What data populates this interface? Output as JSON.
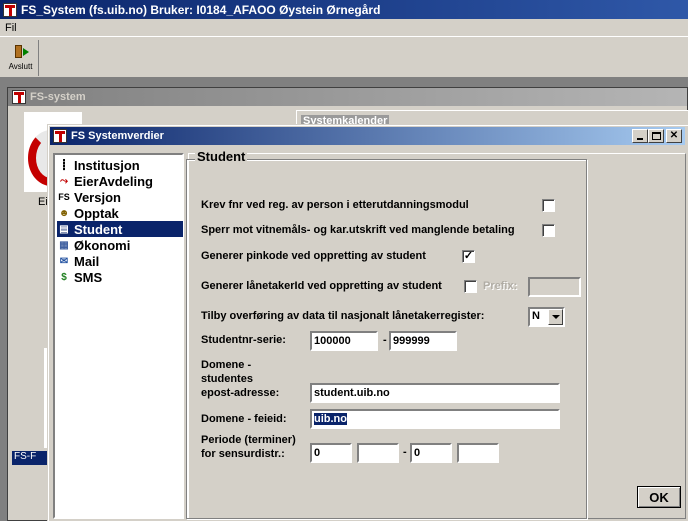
{
  "main_window": {
    "title": "FS_System (fs.uib.no) Bruker: I0184_AFAOO Øystein Ørnegård"
  },
  "menu": {
    "items": [
      "Fil"
    ]
  },
  "toolbar": {
    "exit_label": "Avslutt"
  },
  "background_window": {
    "title": "FS-system",
    "panel_label": "Systemkalender",
    "logo_caption": "Ei",
    "bottom_label": "FS-F"
  },
  "dialog": {
    "title": "FS Systemverdier",
    "nav_items": [
      {
        "label": "Institusjon",
        "icon": "institution-icon"
      },
      {
        "label": "EierAvdeling",
        "icon": "org-chart-icon"
      },
      {
        "label": "Versjon",
        "icon": "fs-version-icon"
      },
      {
        "label": "Opptak",
        "icon": "admission-icon"
      },
      {
        "label": "Student",
        "icon": "student-icon"
      },
      {
        "label": "Økonomi",
        "icon": "economy-icon"
      },
      {
        "label": "Mail",
        "icon": "mail-icon"
      },
      {
        "label": "SMS",
        "icon": "sms-icon"
      }
    ],
    "selected_nav": "Student",
    "group_title": "Student",
    "fields": {
      "krev_fnr_label": "Krev fnr ved reg. av person i etterutdanningsmodul",
      "krev_fnr_checked": false,
      "sperr_label": "Sperr mot vitnemåls- og kar.utskrift ved manglende betaling",
      "sperr_checked": false,
      "pinkode_label": "Generer pinkode ved oppretting av student",
      "pinkode_checked": true,
      "laanetaker_label": "Generer lånetakerId ved oppretting av student",
      "laanetaker_checked": false,
      "prefix_label": "Prefix:",
      "prefix_value": "",
      "tilby_label": "Tilby overføring av data til nasjonalt lånetakerregister:",
      "tilby_value": "N",
      "studentnr_label": "Studentnr-serie:",
      "studentnr_from": "100000",
      "studentnr_to": "999999",
      "dash": "-",
      "domene_epost_label_1": "Domene -",
      "domene_epost_label_2": "studentes",
      "domene_epost_label_3": "epost-adresse:",
      "domene_epost_value": "student.uib.no",
      "domene_feide_label": "Domene - feieid:",
      "domene_feide_value": "uib.no",
      "periode_label_1": "Periode (terminer)",
      "periode_label_2": "for sensurdistr.:",
      "periode_values": [
        "0",
        "",
        "0",
        ""
      ]
    },
    "ok_label": "OK"
  },
  "colors": {
    "title_active": "#0a246a",
    "title_inactive": "#808080",
    "face": "#d4d0c8",
    "logo_red": "#c40000"
  }
}
